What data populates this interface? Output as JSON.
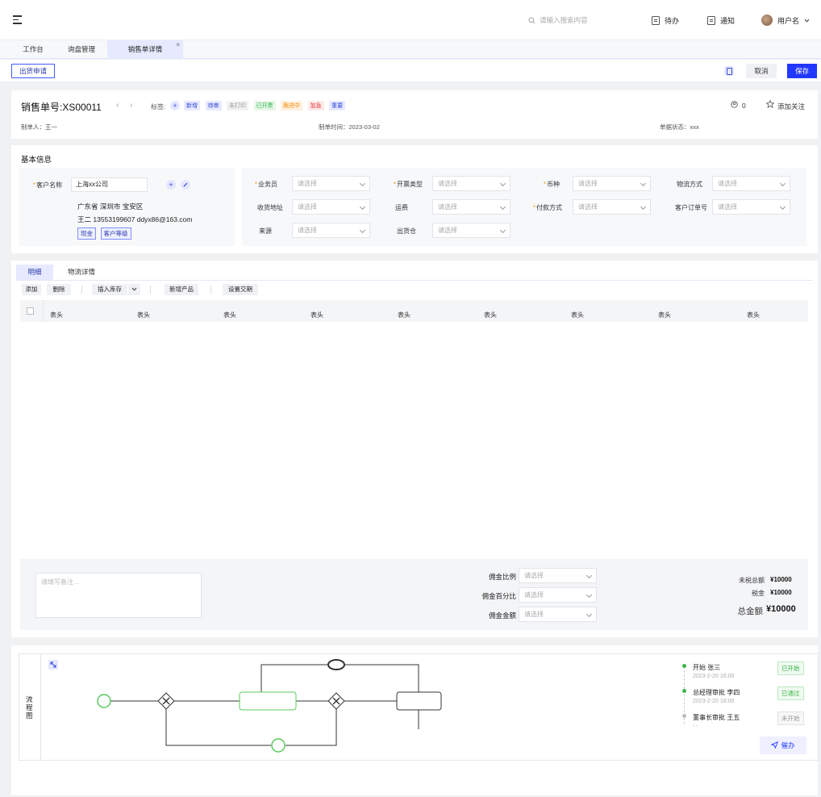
{
  "header": {
    "search_placeholder": "请输入搜索内容",
    "todo_label": "待办",
    "notice_label": "通知",
    "user_label": "用户名"
  },
  "tabs": [
    {
      "label": "工作台"
    },
    {
      "label": "询盘管理"
    },
    {
      "label": "销售单详情",
      "close": "×"
    }
  ],
  "toolbar": {
    "ship_request": "出货申请",
    "cancel": "取消",
    "save": "保存"
  },
  "order": {
    "title": "销售单号:XS00011",
    "prev": "‹",
    "next": "›",
    "tags_label": "标签:",
    "tags": [
      "新增",
      "待审",
      "未打印",
      "已开票",
      "跟进中",
      "加急",
      "重要"
    ],
    "watch_count": "0",
    "watch_label": "添加关注",
    "creator": "制单人：王一",
    "created_time": "制单时间：2023-03-02",
    "doc_status": "单据状态：xxx"
  },
  "basic": {
    "title": "基本信息",
    "customer_label": "客户名称",
    "customer_value": "上海xx公司",
    "address": "广东省  深圳市  宝安区",
    "contact": "王二  13553199607  ddyx86@163.com",
    "badges": [
      "现金",
      "客户等级"
    ],
    "placeholder": "请选择",
    "fields": [
      {
        "label": "业务员",
        "required": true
      },
      {
        "label": "开票类型",
        "required": true
      },
      {
        "label": "币种",
        "required": true
      },
      {
        "label": "物流方式",
        "required": false
      },
      {
        "label": "收货地址",
        "required": false
      },
      {
        "label": "运费",
        "required": false
      },
      {
        "label": "付款方式",
        "required": true
      },
      {
        "label": "客户订单号",
        "required": false
      },
      {
        "label": "来源",
        "required": false
      },
      {
        "label": "出货仓",
        "required": false
      }
    ]
  },
  "detail": {
    "tabs": [
      "明细",
      "物流详情"
    ],
    "buttons": [
      "添加",
      "删除",
      "插入库存",
      "新增产品",
      "设置交期"
    ],
    "headers": [
      "表头",
      "表头",
      "表头",
      "表头",
      "表头",
      "表头",
      "表头",
      "表头",
      "表头"
    ]
  },
  "summary": {
    "remark_placeholder": "请填写备注...",
    "commission_ratio": "佣金比例",
    "commission_percent": "佣金百分比",
    "commission_amount": "佣金金额",
    "placeholder": "请选择",
    "untaxed_label": "未税总额",
    "untaxed_value": "¥10000",
    "tax_label": "税金",
    "tax_value": "¥10000",
    "total_label": "总金额",
    "total_value": "¥10000"
  },
  "flow": {
    "title": "流程图",
    "steps": [
      {
        "name": "开始  张三",
        "time": "2023-2-20 16:00",
        "status": "已开始",
        "color": "#3bb54a"
      },
      {
        "name": "总经理审批  李四",
        "time": "2023-2-20 16:00",
        "status": "已通过",
        "color": "#3bb54a"
      },
      {
        "name": "董事长审批  王五",
        "time": "- -",
        "status": "未开始",
        "color": "#999999"
      }
    ],
    "urge": "催办"
  }
}
